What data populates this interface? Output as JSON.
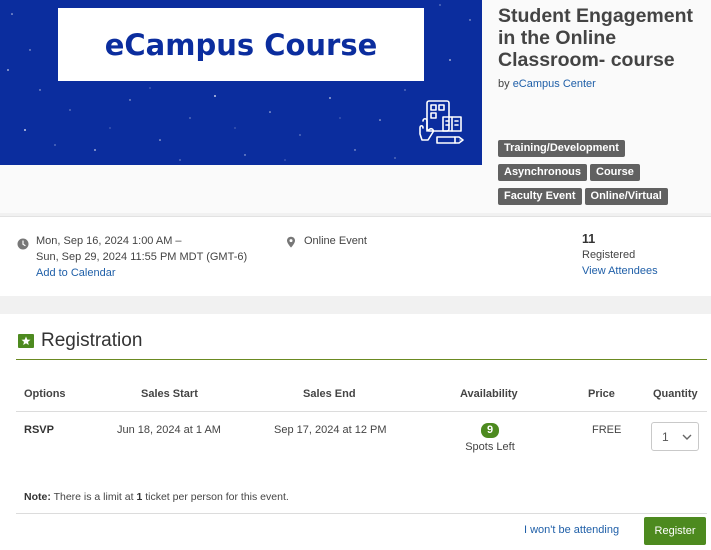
{
  "banner": {
    "title": "eCampus Course"
  },
  "event": {
    "title": "Student Engagement in the Online Classroom- course",
    "by_prefix": "by",
    "organizer": "eCampus Center",
    "tags": [
      "Training/Development",
      "Asynchronous",
      "Course",
      "Faculty Event",
      "Online/Virtual"
    ]
  },
  "info": {
    "date_line1": "Mon, Sep 16, 2024 1:00 AM –",
    "date_line2": "Sun, Sep 29, 2024 11:55 PM MDT (GMT-6)",
    "add_calendar": "Add to Calendar",
    "location": "Online Event",
    "registered_count": "11",
    "registered_label": "Registered",
    "view_attendees": "View Attendees"
  },
  "registration": {
    "title": "Registration",
    "columns": {
      "options": "Options",
      "sales_start": "Sales Start",
      "sales_end": "Sales End",
      "availability": "Availability",
      "price": "Price",
      "quantity": "Quantity"
    },
    "row": {
      "option": "RSVP",
      "sales_start": "Jun 18, 2024 at 1 AM",
      "sales_end": "Sep 17, 2024 at 12 PM",
      "spots_count": "9",
      "spots_label": "Spots Left",
      "price": "FREE",
      "quantity": "1"
    },
    "note_label": "Note:",
    "note_text_1": "There is a limit at",
    "note_limit": "1",
    "note_text_2": "ticket per person for this event.",
    "not_attending": "I won't be attending",
    "register_button": "Register"
  },
  "colors": {
    "banner_blue": "#0b2d9e",
    "accent_green": "#4d8a1f",
    "link_blue": "#1f5fa8",
    "tag_gray": "#616161"
  }
}
